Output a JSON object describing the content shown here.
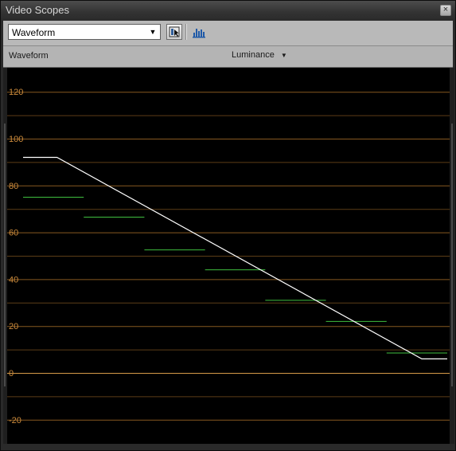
{
  "window": {
    "title": "Video Scopes",
    "close_glyph": "×"
  },
  "toolbar": {
    "scope_type": "Waveform",
    "dropdown_icon": "chevron-down-icon",
    "select_region_icon": "select-region-icon",
    "histogram_icon": "histogram-icon"
  },
  "header": {
    "title": "Waveform",
    "channel": "Luminance",
    "channel_icon": "chevron-down-icon"
  },
  "colors": {
    "grid": "#a86f2a",
    "zero_line": "#d59a48",
    "label": "#cc8b3c",
    "trace": "#ffffff",
    "steps": "#3fbf3f",
    "background": "#000000"
  },
  "chart_data": {
    "type": "line",
    "title": "",
    "xlabel": "",
    "ylabel": "",
    "ylim": [
      -30,
      130
    ],
    "xlim": [
      0,
      100
    ],
    "grid": true,
    "y_ticks": [
      "120",
      "100",
      "80",
      "60",
      "40",
      "20",
      "0",
      "-20"
    ],
    "y_tick_values": [
      120,
      100,
      80,
      60,
      40,
      20,
      0,
      -20
    ],
    "minor_grid_values": [
      110,
      90,
      70,
      50,
      30,
      10,
      -10
    ],
    "series": [
      {
        "x": [
          0,
          8,
          94,
          100
        ],
        "y": [
          92,
          92,
          6,
          6
        ]
      }
    ],
    "steps": [
      {
        "x0": 0,
        "x1": 14.3,
        "y": 75
      },
      {
        "x0": 14.3,
        "x1": 28.6,
        "y": 66.5
      },
      {
        "x0": 28.6,
        "x1": 42.9,
        "y": 52.5
      },
      {
        "x0": 42.9,
        "x1": 57.1,
        "y": 44
      },
      {
        "x0": 57.1,
        "x1": 71.4,
        "y": 31
      },
      {
        "x0": 71.4,
        "x1": 85.7,
        "y": 22
      },
      {
        "x0": 85.7,
        "x1": 100,
        "y": 8.5
      }
    ]
  }
}
